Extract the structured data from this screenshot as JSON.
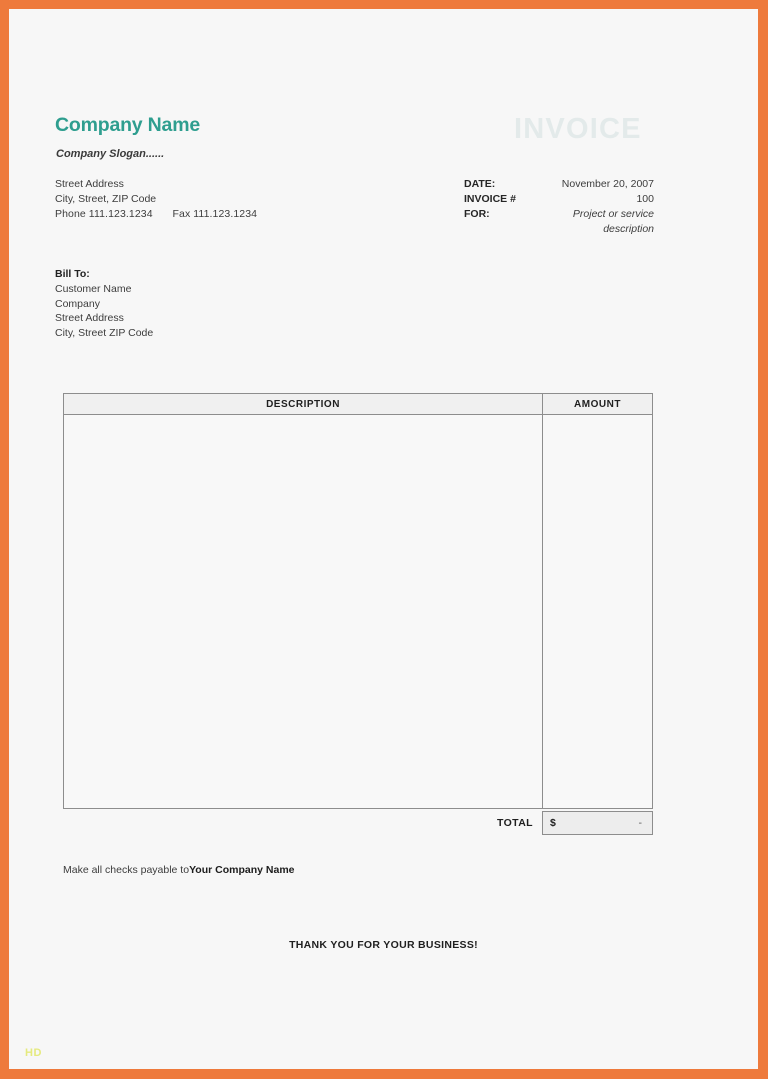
{
  "frame": {
    "border_color": "#ee7a3c",
    "page_background": "#f7f7f7"
  },
  "header": {
    "company_name": "Company Name",
    "company_name_color": "#2e9e8f",
    "company_slogan": "Company Slogan......",
    "street_address": "Street Address",
    "city_line": "City, Street, ZIP Code",
    "phone_label": "Phone",
    "phone_number": "111.123.1234",
    "fax_label": "Fax",
    "fax_number": "111.123.1234",
    "watermark": "INVOICE",
    "watermark_color": "#e3eaea"
  },
  "meta": {
    "rows": [
      {
        "label": "DATE:",
        "value": "November 20, 2007",
        "italic": false
      },
      {
        "label": "INVOICE #",
        "value": "100",
        "italic": false
      },
      {
        "label": "FOR:",
        "value": "Project or service",
        "italic": true
      },
      {
        "label": "",
        "value": "description",
        "italic": true
      }
    ]
  },
  "bill_to": {
    "title": "Bill To:",
    "lines": [
      "Customer Name",
      "Company",
      "Street Address",
      "City, Street  ZIP Code"
    ]
  },
  "table": {
    "headers": {
      "description": "DESCRIPTION",
      "amount": "AMOUNT"
    },
    "rows": [],
    "total_label": "TOTAL",
    "total_currency": "$",
    "total_value": "-"
  },
  "footer": {
    "payable_prefix": "Make all checks payable to",
    "payable_company": "Your Company Name",
    "thanks": "THANK YOU FOR YOUR BUSINESS!"
  },
  "watermark_badge": {
    "label": "HD",
    "color": "#e2e86a"
  }
}
